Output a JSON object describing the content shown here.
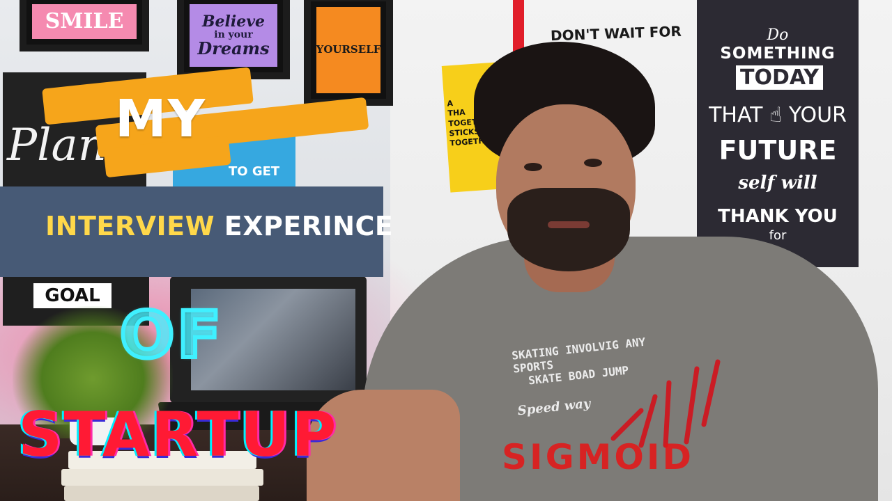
{
  "thumbnail": {
    "title_line1": "MY",
    "title_line2_highlight": "INTERVIEW",
    "title_line2_rest": " EXPERINCE",
    "title_line3": "OF",
    "title_line4": "STARTUP",
    "company": "SIGMOID"
  },
  "wall_posters": {
    "top_frame_left": "SMILE",
    "top_frame_mid_line1": "Believe",
    "top_frame_mid_line2": "in your",
    "top_frame_mid_line3": "Dreams",
    "top_frame_right": "YOURSELF",
    "plan_poster": "Plan",
    "blue_poster": "TO GET",
    "goal_sign": "GOAL",
    "dont_wait": "DON'T WAIT FOR",
    "yellow_poster": "A\nTHA\nTOGET\nSTICKS\nTOGETHER"
  },
  "right_poster": {
    "line1": "Do",
    "line2": "SOMETHING",
    "line3": "TODAY",
    "line4": "THAT ☝ YOUR",
    "line5": "FUTURE",
    "line6": "self will",
    "line7": "THANK YOU",
    "line8": "for"
  },
  "shirt_print": {
    "line1": "SKATING INVOLVIG ANY SPORTS",
    "line2": "SKATE BOAD JUMP",
    "line3": "Speed way"
  },
  "colors": {
    "banner_orange": "#f6a51b",
    "interview_box": "#475a76",
    "interview_highlight": "#ffd84a",
    "of_cyan": "#3ff0ff",
    "startup_red": "#ff1a34",
    "sigmoid_red": "#e61414"
  }
}
